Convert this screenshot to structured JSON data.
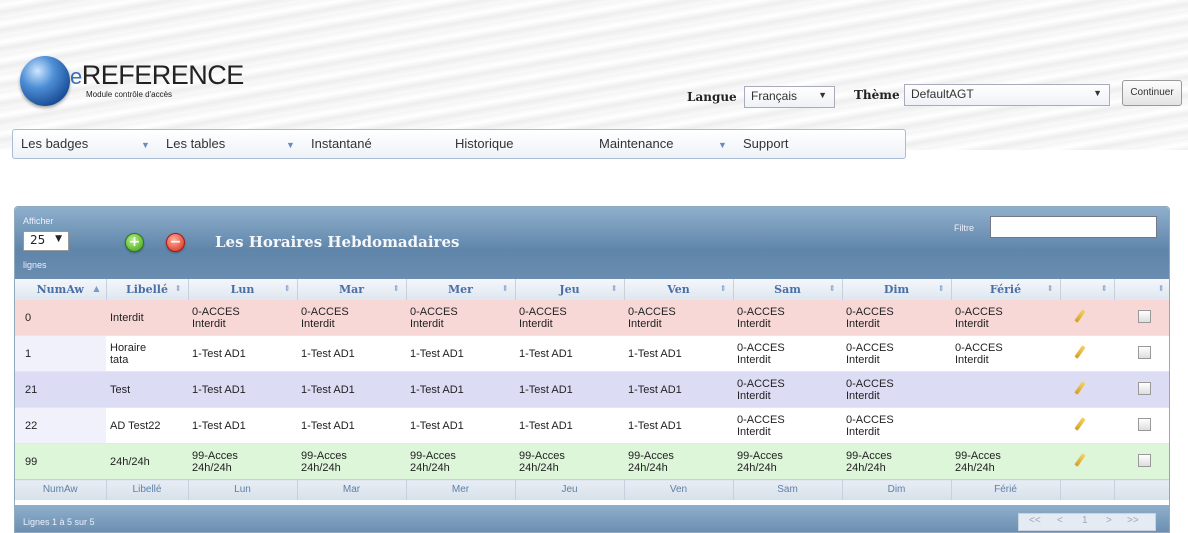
{
  "logo": {
    "brand_prefix": "e",
    "brand_name": "REFERENCE",
    "subtitle": "Module contrôle d'accès"
  },
  "header": {
    "langue_label": "Langue",
    "langue_value": "Français",
    "theme_label": "Thème",
    "theme_value": "DefaultAGT",
    "continuer_label": "Continuer"
  },
  "menu": [
    {
      "label": "Les badges",
      "has_dropdown": true
    },
    {
      "label": "Les tables",
      "has_dropdown": true
    },
    {
      "label": "Instantané",
      "has_dropdown": false
    },
    {
      "label": "Historique",
      "has_dropdown": false
    },
    {
      "label": "Maintenance",
      "has_dropdown": true
    },
    {
      "label": "Support",
      "has_dropdown": false
    }
  ],
  "panel": {
    "afficher_label": "Afficher",
    "rows_value": "25",
    "lignes_label": "lignes",
    "title": "Les Horaires Hebdomadaires",
    "filtre_label": "Filtre",
    "filtre_value": ""
  },
  "table": {
    "headers": [
      "NumAw",
      "Libellé",
      "Lun",
      "Mar",
      "Mer",
      "Jeu",
      "Ven",
      "Sam",
      "Dim",
      "Férié",
      "",
      ""
    ],
    "rows": [
      [
        "0",
        "Interdit",
        "0-ACCES\nInterdit",
        "0-ACCES\nInterdit",
        "0-ACCES\nInterdit",
        "0-ACCES\nInterdit",
        "0-ACCES\nInterdit",
        "0-ACCES\nInterdit",
        "0-ACCES\nInterdit",
        "0-ACCES\nInterdit"
      ],
      [
        "1",
        "Horaire\ntata",
        "1-Test AD1",
        "1-Test AD1",
        "1-Test AD1",
        "1-Test AD1",
        "1-Test AD1",
        "0-ACCES\nInterdit",
        "0-ACCES\nInterdit",
        "0-ACCES\nInterdit"
      ],
      [
        "21",
        "Test",
        "1-Test AD1",
        "1-Test AD1",
        "1-Test AD1",
        "1-Test AD1",
        "1-Test AD1",
        "0-ACCES\nInterdit",
        "0-ACCES\nInterdit",
        ""
      ],
      [
        "22",
        "AD Test22",
        "1-Test AD1",
        "1-Test AD1",
        "1-Test AD1",
        "1-Test AD1",
        "1-Test AD1",
        "0-ACCES\nInterdit",
        "0-ACCES\nInterdit",
        ""
      ],
      [
        "99",
        "24h/24h",
        "99-Acces\n24h/24h",
        "99-Acces\n24h/24h",
        "99-Acces\n24h/24h",
        "99-Acces\n24h/24h",
        "99-Acces\n24h/24h",
        "99-Acces\n24h/24h",
        "99-Acces\n24h/24h",
        "99-Acces\n24h/24h"
      ]
    ],
    "footer": [
      "NumAw",
      "Libellé",
      "Lun",
      "Mar",
      "Mer",
      "Jeu",
      "Ven",
      "Sam",
      "Dim",
      "Férié",
      "",
      ""
    ]
  },
  "pagination": {
    "info": "Lignes 1 à 5 sur 5",
    "first": "<<",
    "prev": "<",
    "page": "1",
    "next": ">",
    "last": ">>"
  }
}
